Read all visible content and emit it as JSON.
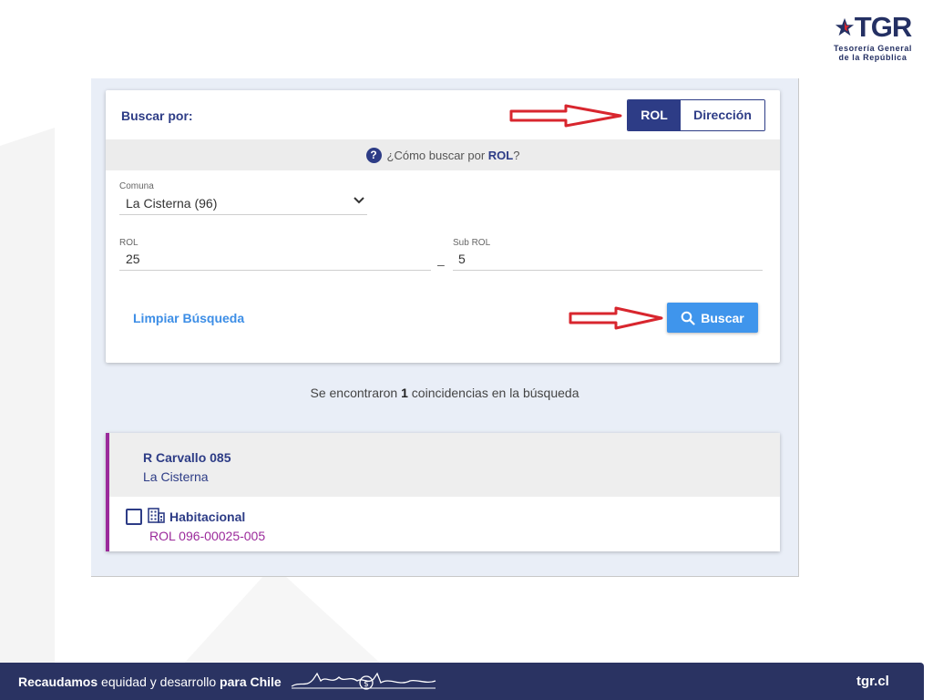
{
  "logo": {
    "name": "TGR",
    "line1": "Tesorería General",
    "line2": "de la República"
  },
  "search": {
    "title": "Buscar por:",
    "mode_rol": "ROL",
    "mode_direccion": "Dirección",
    "help_prefix": "¿Cómo buscar por",
    "help_bold": "ROL",
    "help_suffix": "?",
    "comuna_label": "Comuna",
    "comuna_value": "La Cisterna (96)",
    "rol_label": "ROL",
    "rol_value": "25",
    "separator": "–",
    "subrol_label": "Sub ROL",
    "subrol_value": "5",
    "clear_label": "Limpiar Búsqueda",
    "search_label": "Buscar"
  },
  "results": {
    "prefix": "Se encontraron",
    "count": "1",
    "suffix": "coincidencias en la búsqueda",
    "items": [
      {
        "address": "R Carvallo 085",
        "comuna": "La Cisterna",
        "type": "Habitacional",
        "rol": "ROL 096-00025-005"
      }
    ]
  },
  "footer": {
    "slogan_bold1": "Recaudamos",
    "slogan_light": "equidad y desarrollo",
    "slogan_bold2": "para Chile",
    "url": "tgr.cl"
  },
  "colors": {
    "brand": "#2d3c86",
    "accent": "#3f95ec",
    "result_accent": "#9b2a9b",
    "footer": "#2a3362",
    "arrow": "#d8262e"
  }
}
